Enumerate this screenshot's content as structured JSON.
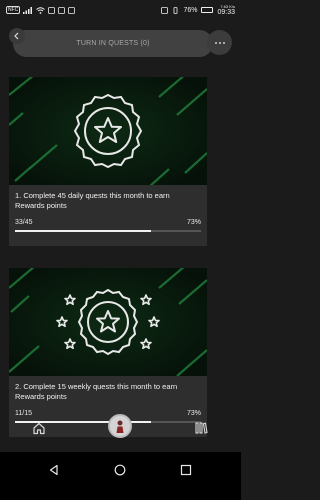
{
  "status_bar": {
    "left_badge": "NFC",
    "battery_percent": "76%",
    "time": "09:33",
    "data_speed": "7.63 K/s"
  },
  "header": {
    "back_icon": "chevron-left-icon",
    "turn_in_label": "TURN IN QUESTS (0)",
    "more_icon": "more-horizontal-icon"
  },
  "quests": [
    {
      "title": "1. Complete 45 daily quests this month to earn Rewards points",
      "progress_text": "33/45",
      "percent_text": "73%",
      "progress_fraction": 0.73,
      "hero_icon": "star-badge-icon"
    },
    {
      "title": "2. Complete 15 weekly quests this month to earn Rewards points",
      "progress_text": "11/15",
      "percent_text": "73%",
      "progress_fraction": 0.73,
      "hero_icon": "star-badge-with-stars-icon"
    }
  ],
  "colors": {
    "background": "#1b1b1b",
    "card": "#2e2e2e",
    "accent_green": "#1f7a3a",
    "progress_fill": "#f2f2f2"
  },
  "bottom_nav": {
    "home_icon": "home-icon",
    "avatar_icon": "avatar",
    "library_icon": "library-icon"
  }
}
